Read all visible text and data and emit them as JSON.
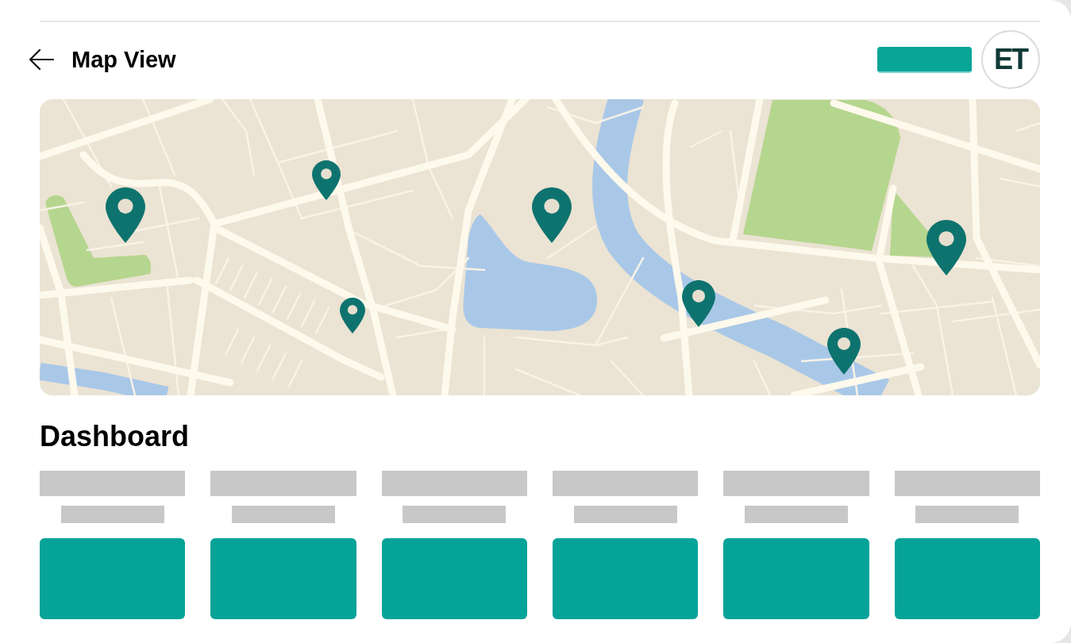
{
  "header": {
    "title": "Map View",
    "avatar": {
      "initials": "ET"
    }
  },
  "dashboard": {
    "title": "Dashboard",
    "cards": [
      {
        "loading": true
      },
      {
        "loading": true
      },
      {
        "loading": true
      },
      {
        "loading": true
      },
      {
        "loading": true
      },
      {
        "loading": true
      }
    ]
  }
}
